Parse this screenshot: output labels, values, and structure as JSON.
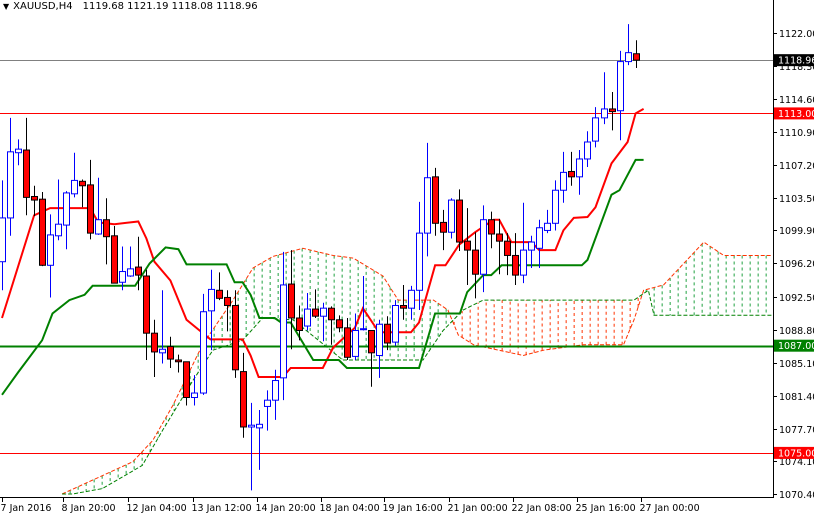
{
  "header": {
    "symbol": "XAUUSD,H4",
    "ohlc": "1119.68 1121.19 1118.08 1118.96",
    "menu_icon": "triangle-down-icon"
  },
  "colors": {
    "bull": "#0000ff",
    "bear_fill": "#ff0000",
    "bear_outline": "#000000",
    "tenkan": "#ff0000",
    "kijun": "#008000",
    "cloud_bull": "#20a040",
    "cloud_bear": "#ff3300",
    "grid_axis": "#000000"
  },
  "chart_data": {
    "type": "candlestick",
    "title": "XAUUSD,H4",
    "x_unit": "bar index",
    "ylim": [
      1070.4,
      1122.0
    ],
    "y_ticks": [
      "1122.00",
      "1118.30",
      "1114.60",
      "1110.90",
      "1107.20",
      "1103.50",
      "1099.90",
      "1096.20",
      "1092.50",
      "1088.80",
      "1085.10",
      "1081.40",
      "1077.70",
      "1074.10",
      "1070.40"
    ],
    "x_tick_labels": [
      "7 Jan 2016",
      "8 Jan 20:00",
      "12 Jan 04:00",
      "13 Jan 12:00",
      "14 Jan 20:00",
      "18 Jan 04:00",
      "19 Jan 16:00",
      "21 Jan 00:00",
      "22 Jan 08:00",
      "25 Jan 16:00",
      "27 Jan 00:00"
    ],
    "x_tick_bars": [
      0,
      7.6,
      15.7,
      23.8,
      31.8,
      39.8,
      47.6,
      55.7,
      63.7,
      71.7,
      79.7
    ],
    "candles": [
      [
        1096.4,
        1105.5,
        1093.2,
        1101.3
      ],
      [
        1101.3,
        1112.5,
        1099.3,
        1108.7
      ],
      [
        1108.6,
        1110.1,
        1107.2,
        1109.0
      ],
      [
        1108.9,
        1112.5,
        1101.6,
        1103.6
      ],
      [
        1103.7,
        1104.9,
        1101.5,
        1103.3
      ],
      [
        1103.4,
        1104.2,
        1095.9,
        1096.0
      ],
      [
        1096.0,
        1101.7,
        1092.4,
        1099.4
      ],
      [
        1099.3,
        1105.6,
        1098.8,
        1100.6
      ],
      [
        1100.5,
        1104.3,
        1097.8,
        1104.1
      ],
      [
        1104.0,
        1108.6,
        1103.6,
        1105.5
      ],
      [
        1105.4,
        1105.6,
        1102.5,
        1104.9
      ],
      [
        1105.0,
        1107.8,
        1098.9,
        1099.6
      ],
      [
        1099.5,
        1105.8,
        1099.4,
        1101.1
      ],
      [
        1101.1,
        1103.5,
        1096.1,
        1099.2
      ],
      [
        1099.3,
        1100.4,
        1094.0,
        1094.0
      ],
      [
        1094.1,
        1098.1,
        1093.2,
        1095.3
      ],
      [
        1094.8,
        1098.1,
        1094.7,
        1095.6
      ],
      [
        1095.8,
        1099.2,
        1093.2,
        1094.9
      ],
      [
        1094.8,
        1095.5,
        1085.4,
        1088.4
      ],
      [
        1088.4,
        1089.9,
        1083.5,
        1086.3
      ],
      [
        1086.2,
        1093.2,
        1085.0,
        1086.6
      ],
      [
        1086.9,
        1088.0,
        1084.5,
        1085.5
      ],
      [
        1085.4,
        1086.0,
        1084.0,
        1085.2
      ],
      [
        1085.2,
        1085.2,
        1080.3,
        1081.2
      ],
      [
        1081.2,
        1083.7,
        1080.3,
        1081.7
      ],
      [
        1081.7,
        1092.8,
        1081.5,
        1090.8
      ],
      [
        1090.9,
        1095.5,
        1086.5,
        1093.3
      ],
      [
        1093.2,
        1095.2,
        1092.1,
        1092.3
      ],
      [
        1092.4,
        1093.2,
        1088.6,
        1091.5
      ],
      [
        1091.5,
        1093.2,
        1083.4,
        1084.3
      ],
      [
        1084.1,
        1086.2,
        1076.7,
        1077.9
      ],
      [
        1077.9,
        1080.6,
        1070.8,
        1078.1
      ],
      [
        1077.8,
        1079.8,
        1073.1,
        1078.2
      ],
      [
        1080.2,
        1082.0,
        1077.5,
        1080.9
      ],
      [
        1080.9,
        1084.3,
        1078.7,
        1083.1
      ],
      [
        1083.4,
        1097.5,
        1080.9,
        1093.8
      ],
      [
        1093.9,
        1097.7,
        1086.6,
        1090.1
      ],
      [
        1090.1,
        1091.5,
        1087.6,
        1088.7
      ],
      [
        1089.2,
        1092.9,
        1088.7,
        1091.1
      ],
      [
        1091.1,
        1093.3,
        1090.1,
        1090.3
      ],
      [
        1090.3,
        1091.8,
        1087.5,
        1091.2
      ],
      [
        1091.2,
        1091.4,
        1087.1,
        1089.9
      ],
      [
        1089.9,
        1090.4,
        1088.5,
        1089.0
      ],
      [
        1089.0,
        1090.1,
        1085.4,
        1085.7
      ],
      [
        1085.8,
        1090.6,
        1085.4,
        1088.7
      ],
      [
        1088.8,
        1094.8,
        1088.7,
        1088.9
      ],
      [
        1088.7,
        1088.7,
        1082.4,
        1086.2
      ],
      [
        1085.9,
        1089.9,
        1083.4,
        1089.4
      ],
      [
        1089.4,
        1090.3,
        1086.5,
        1087.3
      ],
      [
        1087.4,
        1092.1,
        1087.0,
        1091.5
      ],
      [
        1091.5,
        1093.8,
        1089.9,
        1091.2
      ],
      [
        1091.2,
        1093.7,
        1089.9,
        1093.2
      ],
      [
        1093.2,
        1103.1,
        1091.0,
        1099.6
      ],
      [
        1099.6,
        1109.7,
        1097.0,
        1105.8
      ],
      [
        1105.9,
        1106.9,
        1099.3,
        1100.7
      ],
      [
        1100.8,
        1102.2,
        1097.7,
        1099.7
      ],
      [
        1099.7,
        1103.5,
        1099.0,
        1103.3
      ],
      [
        1103.3,
        1104.5,
        1097.6,
        1098.6
      ],
      [
        1098.7,
        1102.4,
        1093.8,
        1097.7
      ],
      [
        1097.7,
        1099.7,
        1092.3,
        1095.0
      ],
      [
        1095.0,
        1102.7,
        1093.0,
        1101.1
      ],
      [
        1101.1,
        1102.0,
        1097.9,
        1099.5
      ],
      [
        1099.5,
        1101.2,
        1095.0,
        1098.7
      ],
      [
        1098.7,
        1099.6,
        1094.9,
        1097.1
      ],
      [
        1097.1,
        1099.6,
        1093.8,
        1094.9
      ],
      [
        1094.9,
        1103.0,
        1094.0,
        1097.7
      ],
      [
        1097.7,
        1099.3,
        1095.7,
        1098.6
      ],
      [
        1097.9,
        1101.1,
        1095.7,
        1100.2
      ],
      [
        1099.9,
        1102.2,
        1099.6,
        1100.7
      ],
      [
        1100.7,
        1105.5,
        1099.9,
        1104.4
      ],
      [
        1104.4,
        1108.7,
        1103.0,
        1106.4
      ],
      [
        1106.5,
        1108.7,
        1104.9,
        1105.9
      ],
      [
        1105.9,
        1108.9,
        1103.9,
        1107.9
      ],
      [
        1107.9,
        1111.0,
        1107.0,
        1109.8
      ],
      [
        1109.9,
        1113.7,
        1109.2,
        1112.5
      ],
      [
        1112.5,
        1117.6,
        1111.8,
        1113.5
      ],
      [
        1113.5,
        1115.4,
        1111.1,
        1113.2
      ],
      [
        1113.3,
        1120.0,
        1110.0,
        1118.8
      ],
      [
        1118.8,
        1123.0,
        1118.4,
        1119.8
      ],
      [
        1119.68,
        1121.19,
        1118.08,
        1118.96
      ]
    ],
    "tenkan": [
      [
        0,
        1090.1
      ],
      [
        4,
        1101.6
      ],
      [
        6,
        1102.4
      ],
      [
        11,
        1102.4
      ],
      [
        12,
        1100.8
      ],
      [
        14,
        1100.6
      ],
      [
        17,
        1100.9
      ],
      [
        18,
        1099.0
      ],
      [
        19,
        1096.4
      ],
      [
        21,
        1094.3
      ],
      [
        23,
        1089.9
      ],
      [
        26,
        1087.7
      ],
      [
        30,
        1087.7
      ],
      [
        31,
        1085.9
      ],
      [
        32,
        1083.5
      ],
      [
        35,
        1083.5
      ],
      [
        36,
        1084.5
      ],
      [
        40,
        1084.5
      ],
      [
        41.3,
        1086.8
      ],
      [
        44,
        1089.0
      ],
      [
        45,
        1091.2
      ],
      [
        47,
        1088.5
      ],
      [
        51,
        1088.5
      ],
      [
        52,
        1089.6
      ],
      [
        54,
        1096.0
      ],
      [
        55.3,
        1096.0
      ],
      [
        57,
        1098.3
      ],
      [
        59,
        1099.7
      ],
      [
        61.3,
        1101.1
      ],
      [
        62,
        1101.1
      ],
      [
        63.5,
        1098.6
      ],
      [
        66,
        1098.6
      ],
      [
        67,
        1097.7
      ],
      [
        69,
        1097.7
      ],
      [
        70,
        1099.9
      ],
      [
        71.3,
        1101.3
      ],
      [
        73,
        1101.4
      ],
      [
        74,
        1102.5
      ],
      [
        76,
        1107.4
      ],
      [
        78,
        1109.8
      ],
      [
        79,
        1113.0
      ],
      [
        80,
        1113.5
      ]
    ],
    "kijun": [
      [
        0,
        1081.5
      ],
      [
        2,
        1084.0
      ],
      [
        5,
        1087.6
      ],
      [
        6.3,
        1090.6
      ],
      [
        8.4,
        1092.1
      ],
      [
        10.3,
        1092.7
      ],
      [
        11.3,
        1093.7
      ],
      [
        16.6,
        1093.7
      ],
      [
        18.4,
        1096.2
      ],
      [
        20.4,
        1098.0
      ],
      [
        22,
        1097.8
      ],
      [
        23,
        1096.1
      ],
      [
        28,
        1096.1
      ],
      [
        29,
        1094.1
      ],
      [
        30,
        1094.1
      ],
      [
        31,
        1092.7
      ],
      [
        32.1,
        1090.1
      ],
      [
        34,
        1090.1
      ],
      [
        34.8,
        1089.6
      ],
      [
        36,
        1089.6
      ],
      [
        38.8,
        1085.4
      ],
      [
        42,
        1085.4
      ],
      [
        43,
        1084.5
      ],
      [
        52,
        1084.5
      ],
      [
        54,
        1090.6
      ],
      [
        57.1,
        1090.6
      ],
      [
        58,
        1093.0
      ],
      [
        60,
        1094.9
      ],
      [
        61,
        1094.9
      ],
      [
        62.3,
        1096.0
      ],
      [
        72.3,
        1096.0
      ],
      [
        73,
        1096.6
      ],
      [
        76,
        1103.9
      ],
      [
        77,
        1104.4
      ],
      [
        79,
        1107.8
      ],
      [
        80,
        1107.8
      ]
    ],
    "senkou_a": [
      [
        7.5,
        1070.4
      ],
      [
        11.9,
        1072.2
      ],
      [
        16.3,
        1074.0
      ],
      [
        18.8,
        1076.4
      ],
      [
        21.3,
        1080.3
      ],
      [
        25,
        1087.1
      ],
      [
        28.8,
        1092.1
      ],
      [
        31.3,
        1095.7
      ],
      [
        33.8,
        1097.0
      ],
      [
        37.5,
        1097.9
      ],
      [
        41.3,
        1097.1
      ],
      [
        43.8,
        1096.8
      ],
      [
        47.5,
        1094.8
      ],
      [
        49.4,
        1092.1
      ],
      [
        53.8,
        1092.1
      ],
      [
        55.6,
        1091.0
      ],
      [
        56.9,
        1088.2
      ],
      [
        58.8,
        1087.1
      ],
      [
        65,
        1085.9
      ],
      [
        67.5,
        1086.5
      ],
      [
        72.5,
        1087.1
      ],
      [
        77.5,
        1087.1
      ],
      [
        78.8,
        1089.9
      ],
      [
        80,
        1093.2
      ],
      [
        82.5,
        1093.8
      ],
      [
        87.5,
        1098.6
      ],
      [
        90,
        1097.1
      ],
      [
        96,
        1097.1
      ]
    ],
    "senkou_b": [
      [
        7.5,
        1070.4
      ],
      [
        8.8,
        1070.4
      ],
      [
        12.5,
        1071.0
      ],
      [
        17.5,
        1073.6
      ],
      [
        20,
        1077.5
      ],
      [
        23.8,
        1083.1
      ],
      [
        26.3,
        1086.5
      ],
      [
        30,
        1087.6
      ],
      [
        32.5,
        1090.1
      ],
      [
        36.3,
        1089.9
      ],
      [
        42.5,
        1085.4
      ],
      [
        52.5,
        1085.4
      ],
      [
        55,
        1088.7
      ],
      [
        57.5,
        1091.0
      ],
      [
        60,
        1092.1
      ],
      [
        78.8,
        1092.1
      ],
      [
        80.6,
        1093.2
      ],
      [
        81.3,
        1090.4
      ],
      [
        96,
        1090.4
      ]
    ],
    "levels": [
      {
        "price": 1118.96,
        "label": "1118.96",
        "color": "#808080",
        "tag_bg": "#000000",
        "kind": "bid"
      },
      {
        "price": 1113.0,
        "label": "1113.00",
        "color": "#ff0000",
        "tag_bg": "#ff0000",
        "kind": "resistance"
      },
      {
        "price": 1087.0,
        "label": "1087.00",
        "color": "#008000",
        "tag_bg": "#008000",
        "kind": "support"
      },
      {
        "price": 1075.0,
        "label": "1075.00",
        "color": "#ff0000",
        "tag_bg": "#ff0000",
        "kind": "support"
      }
    ]
  }
}
